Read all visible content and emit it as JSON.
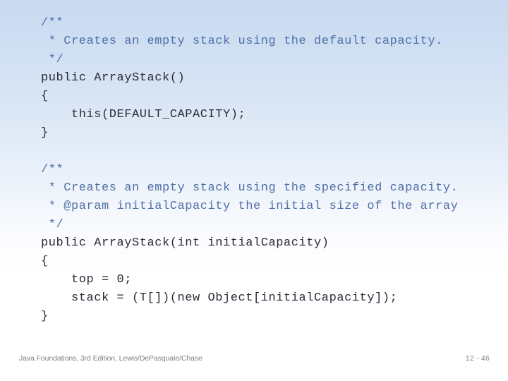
{
  "slide": {
    "background_top_color": "#c8daf0",
    "background_bottom_color": "#ffffff",
    "comment_color": "#4f6fa8",
    "code_color": "#2b2b3a",
    "footer_color": "#808080"
  },
  "code": {
    "language": "java",
    "lines": [
      {
        "text": "/**",
        "kind": "comment"
      },
      {
        "text": " * Creates an empty stack using the default capacity.",
        "kind": "comment"
      },
      {
        "text": " */",
        "kind": "comment"
      },
      {
        "text": "public ArrayStack()",
        "kind": "code"
      },
      {
        "text": "{",
        "kind": "code"
      },
      {
        "text": "    this(DEFAULT_CAPACITY);",
        "kind": "code"
      },
      {
        "text": "}",
        "kind": "code"
      },
      {
        "text": "",
        "kind": "blank"
      },
      {
        "text": "/**",
        "kind": "comment"
      },
      {
        "text": " * Creates an empty stack using the specified capacity.",
        "kind": "comment"
      },
      {
        "text": " * @param initialCapacity the initial size of the array",
        "kind": "comment"
      },
      {
        "text": " */",
        "kind": "comment"
      },
      {
        "text": "public ArrayStack(int initialCapacity)",
        "kind": "code"
      },
      {
        "text": "{",
        "kind": "code"
      },
      {
        "text": "    top = 0;",
        "kind": "code"
      },
      {
        "text": "    stack = (T[])(new Object[initialCapacity]);",
        "kind": "code"
      },
      {
        "text": "}",
        "kind": "code"
      }
    ]
  },
  "footer": {
    "attribution": "Java Foundations, 3rd Edition, Lewis/DePasquale/Chase",
    "page_number": "12 - 46"
  }
}
